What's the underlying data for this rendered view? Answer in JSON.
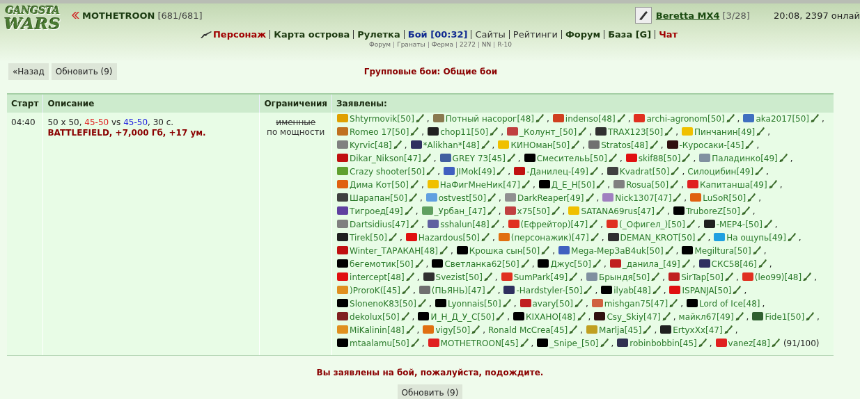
{
  "logo": [
    "GANGSTA",
    "WARS"
  ],
  "user": {
    "name": "MOTHETROON",
    "hp": "[681/681]"
  },
  "weapon": {
    "name": "Beretta MX4",
    "ammo": "[3/28]"
  },
  "clock": "20:08, 2397 онлай",
  "nav": [
    {
      "label": "Персонаж",
      "kind": "red"
    },
    {
      "label": "Карта острова",
      "kind": "bold"
    },
    {
      "label": "Рулетка",
      "kind": "bold"
    },
    {
      "label": "Бой [00:32]",
      "kind": "blue"
    },
    {
      "label": "Сайты",
      "kind": "plain"
    },
    {
      "label": "Рейтинги",
      "kind": "plain"
    },
    {
      "label": "Форум",
      "kind": "bold"
    },
    {
      "label": "База [G]",
      "kind": "bold"
    },
    {
      "label": "Чат",
      "kind": "red"
    }
  ],
  "subnav": [
    "Форум",
    "Гранаты",
    "Ферма",
    "2272",
    "NN",
    "R-10"
  ],
  "buttons": [
    "«Назад",
    "Обновить (9)"
  ],
  "page_title": "Групповые бои: Общие бои",
  "table": {
    "columns": [
      "Старт",
      "Описание",
      "Ограничения",
      "Заявлены:"
    ],
    "rows": [
      {
        "start": "04:40",
        "description": [
          {
            "text": "50 x 50, ",
            "kind": "plain"
          },
          {
            "text": "45-50",
            "kind": "red"
          },
          {
            "text": " vs ",
            "kind": "plain"
          },
          {
            "text": "45-50",
            "kind": "blue"
          },
          {
            "text": ", 30 с.",
            "kind": "plain"
          }
        ],
        "reward": "BATTLEFIELD, +7,000 Гб, +17 ум.",
        "limits": [
          {
            "text": "именные",
            "struck": true
          },
          {
            "text": "по мощности",
            "struck": false
          }
        ],
        "participants": [
          {
            "name": "Shtyrmovik[50]",
            "color": "#e0a000",
            "weapon": true,
            "sep": ","
          },
          {
            "name": "Потный насорог[48]",
            "color": "#8a7a50",
            "weapon": true,
            "sep": ","
          },
          {
            "name": "indenso[48]",
            "color": "#d04020",
            "weapon": true,
            "sep": ","
          },
          {
            "name": "archi-agronom[50]",
            "color": "#e03020",
            "weapon": true,
            "sep": ","
          },
          {
            "name": "aka2017[50]",
            "color": "#4070c0",
            "weapon": true,
            "sep": ","
          },
          {
            "name": "Romeo 17[50]",
            "color": "#c07020",
            "weapon": true,
            "sep": ","
          },
          {
            "name": "chop11[50]",
            "color": "#202020",
            "weapon": true,
            "sep": ","
          },
          {
            "name": "_Колунт_[50]",
            "color": "#c04040",
            "weapon": true,
            "sep": ","
          },
          {
            "name": "TRAX123[50]",
            "color": "#303030",
            "weapon": true,
            "sep": ","
          },
          {
            "name": "Пинчанин[49]",
            "color": "#f0c000",
            "weapon": true,
            "sep": ","
          },
          {
            "name": "Kyrvic[48]",
            "color": "#808080",
            "weapon": true,
            "sep": ","
          },
          {
            "name": "*Alikhan*[48]",
            "color": "#303060",
            "weapon": true,
            "sep": ","
          },
          {
            "name": "КИНОман[50]",
            "color": "#f0c000",
            "weapon": true,
            "sep": ","
          },
          {
            "name": "Stratos[48]",
            "color": "#707070",
            "weapon": true,
            "sep": ","
          },
          {
            "name": "-Куросаки-[45]",
            "color": "#301010",
            "weapon": true,
            "sep": ","
          },
          {
            "name": "Dikar_Nikson[47]",
            "color": "#c01010",
            "weapon": true,
            "sep": ","
          },
          {
            "name": "GREY 73[45]",
            "color": "#4060a0",
            "weapon": true,
            "sep": ","
          },
          {
            "name": "СмесительЬ[50]",
            "color": "#000000",
            "weapon": true,
            "sep": ","
          },
          {
            "name": "skif88[50]",
            "color": "#e01010",
            "weapon": true,
            "sep": ","
          },
          {
            "name": "Паладинко[49]",
            "color": "#8090a0",
            "weapon": true,
            "sep": ","
          },
          {
            "name": "Crazy shooter[50]",
            "color": "#60a030",
            "weapon": true,
            "sep": ","
          },
          {
            "name": "JIMok[49]",
            "color": "#4060c0",
            "weapon": true,
            "sep": ","
          },
          {
            "name": "-Данилец-[49]",
            "color": "#c01010",
            "weapon": true,
            "sep": ","
          },
          {
            "name": "Kvadrat[50]",
            "color": "#404040",
            "weapon": true,
            "sep": ","
          },
          {
            "name": "Силоцибин[49]",
            "weapon": true,
            "sep": ","
          },
          {
            "name": "Дима Кот[50]",
            "color": "#e06010",
            "weapon": true,
            "sep": ","
          },
          {
            "name": "НаФигМнеНик[47]",
            "color": "#f0c000",
            "weapon": true,
            "sep": ","
          },
          {
            "name": "Д_Е_Н[50]",
            "color": "#000000",
            "weapon": true,
            "sep": ","
          },
          {
            "name": "Rosua[50]",
            "color": "#808080",
            "weapon": true,
            "sep": ","
          },
          {
            "name": "Капитанша[49]",
            "color": "#e02020",
            "weapon": true,
            "sep": ","
          },
          {
            "name": "Шарапан[50]",
            "color": "#404040",
            "weapon": true,
            "sep": ","
          },
          {
            "name": "ostvest[50]",
            "color": "#60a0e0",
            "weapon": true,
            "sep": ","
          },
          {
            "name": "DarkReaper[49]",
            "color": "#909090",
            "weapon": true,
            "sep": ","
          },
          {
            "name": "Nick1307[47]",
            "color": "#a080c0",
            "weapon": true,
            "sep": ","
          },
          {
            "name": "LuSoR[50]",
            "color": "#e06010",
            "weapon": true,
            "sep": ","
          },
          {
            "name": "Тигроед[49]",
            "color": "#6040a0",
            "weapon": true,
            "sep": ","
          },
          {
            "name": "_Урбан_[47]",
            "color": "#60a060",
            "weapon": true,
            "sep": ","
          },
          {
            "name": "x75[50]",
            "color": "#c04040",
            "weapon": true,
            "sep": ","
          },
          {
            "name": "SATANA69rus[47]",
            "color": "#f0c000",
            "weapon": true,
            "sep": ","
          },
          {
            "name": "TruboreZ[50]",
            "color": "#000000",
            "weapon": true,
            "sep": ","
          },
          {
            "name": "Dartsidius[47]",
            "color": "#808080",
            "weapon": true,
            "sep": ","
          },
          {
            "name": "sshalun[48]",
            "color": "#6060a0",
            "weapon": true,
            "sep": ","
          },
          {
            "name": "(Ефрейтор)[47]",
            "color": "#e03020",
            "weapon": true,
            "sep": ","
          },
          {
            "name": "(_Офигел_)[50]",
            "color": "#e03020",
            "weapon": true,
            "sep": ","
          },
          {
            "name": "-МЕР4-[50]",
            "color": "#202020",
            "weapon": true,
            "sep": ","
          },
          {
            "name": "Tirek[50]",
            "color": "#202020",
            "weapon": true,
            "sep": ","
          },
          {
            "name": "Hazardous[50]",
            "color": "#e01010",
            "weapon": true,
            "sep": ","
          },
          {
            "name": "(персонажик)[47]",
            "color": "#e07010",
            "weapon": true,
            "sep": ","
          },
          {
            "name": "DEMAN_KROT[50]",
            "color": "#303030",
            "weapon": true,
            "sep": ","
          },
          {
            "name": "На ощупь[49]",
            "color": "#20a0e0",
            "weapon": true,
            "sep": ","
          },
          {
            "name": "Winter_ТАРАКАН[48]",
            "color": "#c01010",
            "weapon": true,
            "sep": ","
          },
          {
            "name": "Крошка сын[50]",
            "color": "#000000",
            "weapon": true,
            "sep": ","
          },
          {
            "name": "Mega-МерЗаВ4uk[50]",
            "color": "#4060c0",
            "weapon": true,
            "sep": ","
          },
          {
            "name": "Megiltura[50]",
            "color": "#000000",
            "weapon": true,
            "sep": ","
          },
          {
            "name": "бегемотик[50]",
            "color": "#000000",
            "weapon": true,
            "sep": ","
          },
          {
            "name": "Светланка62[50]",
            "color": "#000000",
            "weapon": true,
            "sep": ","
          },
          {
            "name": "Джус[50]",
            "color": "#000000",
            "weapon": true,
            "sep": ","
          },
          {
            "name": "_данила_[49]",
            "color": "#c02020",
            "weapon": true,
            "sep": ","
          },
          {
            "name": "СКС58[46]",
            "color": "#303060",
            "weapon": true,
            "sep": ","
          },
          {
            "name": "intercept[48]",
            "color": "#e01010",
            "weapon": true,
            "sep": ","
          },
          {
            "name": "Svezist[50]",
            "color": "#303030",
            "weapon": true,
            "sep": ","
          },
          {
            "name": "SumPark[49]",
            "color": "#e03020",
            "weapon": true,
            "sep": ","
          },
          {
            "name": "Брындя[50]",
            "color": "#8090a0",
            "weapon": true,
            "sep": ","
          },
          {
            "name": "SirTap[50]",
            "color": "#c02020",
            "weapon": true,
            "sep": ","
          },
          {
            "name": "(leo99)[48]",
            "color": "#e03020",
            "weapon": true,
            "sep": ","
          },
          {
            "name": ")ProroK([45]",
            "color": "#e09020",
            "weapon": true,
            "sep": ","
          },
          {
            "name": "(ПЬЯНЬ)[47]",
            "color": "#707070",
            "weapon": true,
            "sep": ","
          },
          {
            "name": "-Hardstyler-[50]",
            "color": "#303060",
            "weapon": true,
            "sep": ","
          },
          {
            "name": "ilyab[48]",
            "color": "#000000",
            "weapon": true,
            "sep": ","
          },
          {
            "name": "ISPANJA[50]",
            "color": "#e01010",
            "weapon": true,
            "sep": ","
          },
          {
            "name": "SlonenoK83[50]",
            "color": "#000000",
            "weapon": true,
            "sep": ","
          },
          {
            "name": "Lyonnais[50]",
            "color": "#000000",
            "weapon": true,
            "sep": ","
          },
          {
            "name": "avary[50]",
            "color": "#c02020",
            "weapon": true,
            "sep": ","
          },
          {
            "name": "mishgan75[47]",
            "color": "#d06040",
            "weapon": true,
            "sep": ","
          },
          {
            "name": "Lord of Ice[48]",
            "color": "#000000",
            "weapon": false,
            "sep": ","
          },
          {
            "name": "dekolux[50]",
            "color": "#802020",
            "weapon": true,
            "sep": ","
          },
          {
            "name": "И_Н_Д_У_С[50]",
            "color": "#000000",
            "weapon": true,
            "sep": ","
          },
          {
            "name": "КIХАНО[48]",
            "color": "#000000",
            "weapon": true,
            "sep": ","
          },
          {
            "name": "Csy_Skiy[47]",
            "color": "#301010",
            "weapon": true,
            "sep": ","
          },
          {
            "name": "майкл67[49]",
            "weapon": true,
            "sep": ","
          },
          {
            "name": "Fide1[50]",
            "color": "#306030",
            "weapon": true,
            "sep": ","
          },
          {
            "name": "MiKalinin[48]",
            "color": "#e09020",
            "weapon": true,
            "sep": ","
          },
          {
            "name": "vigy[50]",
            "color": "#e07010",
            "weapon": true,
            "sep": ","
          },
          {
            "name": "Ronald McCrea[45]",
            "weapon": true,
            "sep": ","
          },
          {
            "name": "Marlja[45]",
            "color": "#c0a020",
            "weapon": true,
            "sep": ","
          },
          {
            "name": "ErtyxXx[47]",
            "color": "#202020",
            "weapon": true,
            "sep": ","
          },
          {
            "name": "mtaalamu[50]",
            "color": "#000000",
            "weapon": true,
            "sep": ","
          },
          {
            "name": "MOTHETROON[45]",
            "color": "#e02020",
            "weapon": true,
            "sep": ","
          },
          {
            "name": "_Snipe_[50]",
            "color": "#000000",
            "weapon": true,
            "sep": ","
          },
          {
            "name": "robinbobbin[45]",
            "color": "#303050",
            "weapon": true,
            "sep": ","
          },
          {
            "name": "vanez[48]",
            "color": "#e02020",
            "weapon": true
          }
        ],
        "count": "(91/100)"
      }
    ]
  },
  "notice": "Вы заявлены на бой, пожалуйста, подождите.",
  "bottom_button": "Обновить (9)"
}
